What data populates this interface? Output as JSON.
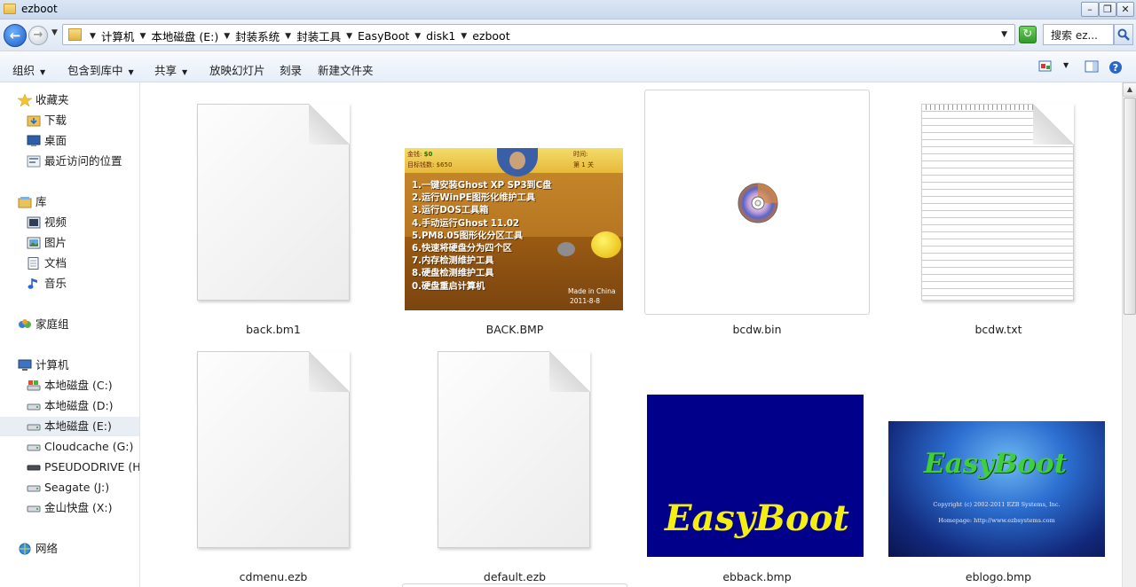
{
  "window": {
    "title": "ezboot"
  },
  "address": {
    "crumbs": [
      "计算机",
      "本地磁盘 (E:)",
      "封装系统",
      "封装工具",
      "EasyBoot",
      "disk1",
      "ezboot"
    ],
    "search_placeholder": "搜索 ez..."
  },
  "toolbar": {
    "organize": "组织",
    "include_library": "包含到库中",
    "share": "共享",
    "slideshow": "放映幻灯片",
    "burn": "刻录",
    "new_folder": "新建文件夹"
  },
  "sidebar": {
    "favorites": {
      "label": "收藏夹",
      "items": [
        "下载",
        "桌面",
        "最近访问的位置"
      ]
    },
    "libraries": {
      "label": "库",
      "items": [
        "视频",
        "图片",
        "文档",
        "音乐"
      ]
    },
    "homegroup": "家庭组",
    "computer": {
      "label": "计算机",
      "items": [
        "本地磁盘 (C:)",
        "本地磁盘 (D:)",
        "本地磁盘 (E:)",
        "Cloudcache (G:)",
        "PSEUDODRIVE (H:",
        "Seagate (J:)",
        "金山快盘 (X:)"
      ],
      "selected": "本地磁盘 (E:)"
    },
    "network": "网络"
  },
  "files": [
    {
      "name": "back.bm1",
      "icon": "blank-document-icon"
    },
    {
      "name": "BACK.BMP",
      "icon": "image-thumbnail"
    },
    {
      "name": "bcdw.bin",
      "icon": "disc-icon"
    },
    {
      "name": "bcdw.txt",
      "icon": "text-document-icon"
    },
    {
      "name": "cdmenu.ezb",
      "icon": "blank-document-icon"
    },
    {
      "name": "default.ezb",
      "icon": "blank-document-icon"
    },
    {
      "name": "ebback.bmp",
      "icon": "image-thumbnail"
    },
    {
      "name": "eblogo.bmp",
      "icon": "image-thumbnail"
    }
  ],
  "back_bmp": {
    "money_label": "金钱:",
    "money_value": "$0",
    "target_label": "目标钱数:",
    "target_value": "$650",
    "time_label": "时间:",
    "level_label": "第",
    "level_value": "1",
    "level_unit": "关",
    "menu": [
      "1.一键安装Ghost XP SP3到C盘",
      "2.运行WinPE图形化维护工具",
      "3.运行DOS工具箱",
      "4.手动运行Ghost 11.02",
      "5.PM8.05图形化分区工具",
      "6.快速将硬盘分为四个区",
      "7.内存检测维护工具",
      "8.硬盘检测维护工具",
      "0.硬盘重启计算机"
    ],
    "made_in": "Made in China",
    "date": "2011-8-8"
  },
  "ebback_bmp": {
    "text": "EasyBoot"
  },
  "eblogo_bmp": {
    "logo": "EasyBoot",
    "copyright": "Copyright (c) 2002-2011 EZB Systems, Inc.",
    "homepage": "Homepage: http://www.ezbsystems.com"
  },
  "colors": {
    "accent": "#1d5cc1",
    "selection": "#e9eef5",
    "ebback_bg": "#00008b",
    "ebback_text": "#f4ee13"
  }
}
